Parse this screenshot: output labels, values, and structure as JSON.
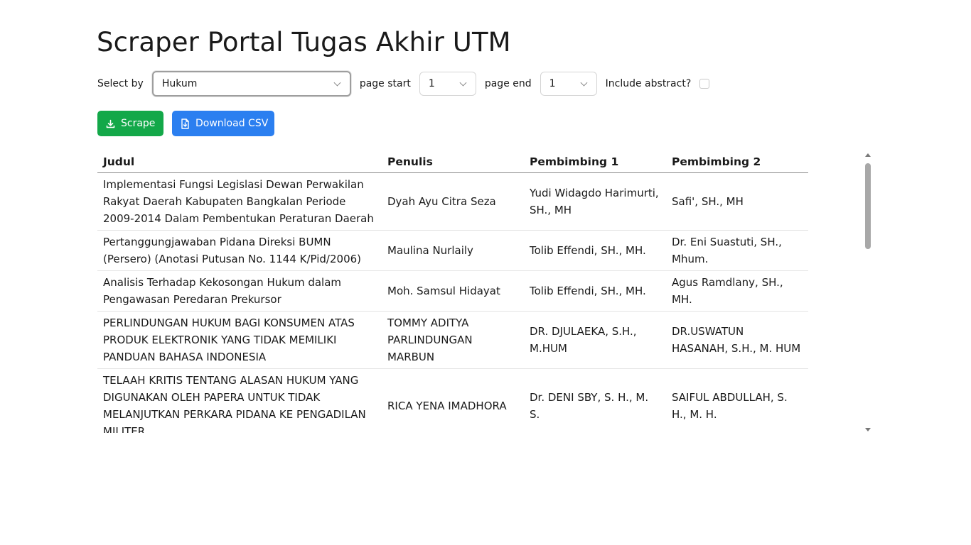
{
  "title": "Scraper Portal Tugas Akhir UTM",
  "controls": {
    "select_by_label": "Select by",
    "select_by_value": "Hukum",
    "page_start_label": "page start",
    "page_start_value": "1",
    "page_end_label": "page end",
    "page_end_value": "1",
    "include_abstract_label": "Include abstract?",
    "include_abstract_checked": false
  },
  "buttons": {
    "scrape_label": "Scrape",
    "download_label": "Download CSV"
  },
  "colors": {
    "scrape_button": "#13a849",
    "download_button": "#2b7ff0"
  },
  "table": {
    "headers": [
      "Judul",
      "Penulis",
      "Pembimbing 1",
      "Pembimbing 2"
    ],
    "rows": [
      [
        "Implementasi Fungsi Legislasi Dewan Perwakilan Rakyat Daerah Kabupaten Bangkalan Periode 2009-2014 Dalam Pembentukan Peraturan Daerah",
        "Dyah Ayu Citra Seza",
        "Yudi Widagdo Harimurti, SH., MH",
        "Safi', SH., MH"
      ],
      [
        "Pertanggungjawaban Pidana Direksi BUMN (Persero) (Anotasi Putusan No. 1144 K/Pid/2006)",
        "Maulina Nurlaily",
        "Tolib Effendi, SH., MH.",
        "Dr. Eni Suastuti, SH., Mhum."
      ],
      [
        "Analisis Terhadap Kekosongan Hukum dalam Pengawasan Peredaran Prekursor",
        "Moh. Samsul Hidayat",
        "Tolib Effendi, SH., MH.",
        "Agus Ramdlany, SH., MH."
      ],
      [
        "PERLINDUNGAN HUKUM BAGI KONSUMEN ATAS PRODUK ELEKTRONIK YANG TIDAK MEMILIKI PANDUAN BAHASA INDONESIA",
        "TOMMY ADITYA PARLINDUNGAN MARBUN",
        "DR. DJULAEKA, S.H., M.HUM",
        "DR.USWATUN HASANAH, S.H., M. HUM"
      ],
      [
        "TELAAH KRITIS TENTANG ALASAN HUKUM YANG DIGUNAKAN OLEH PAPERA UNTUK TIDAK MELANJUTKAN PERKARA PIDANA KE PENGADILAN MILITER",
        "RICA YENA IMADHORA",
        "Dr. DENI SBY, S. H., M. S.",
        "SAIFUL ABDULLAH, S. H., M. H."
      ]
    ]
  },
  "icons": {
    "scrape_icon": "download-icon",
    "download_icon": "file-download-icon"
  }
}
